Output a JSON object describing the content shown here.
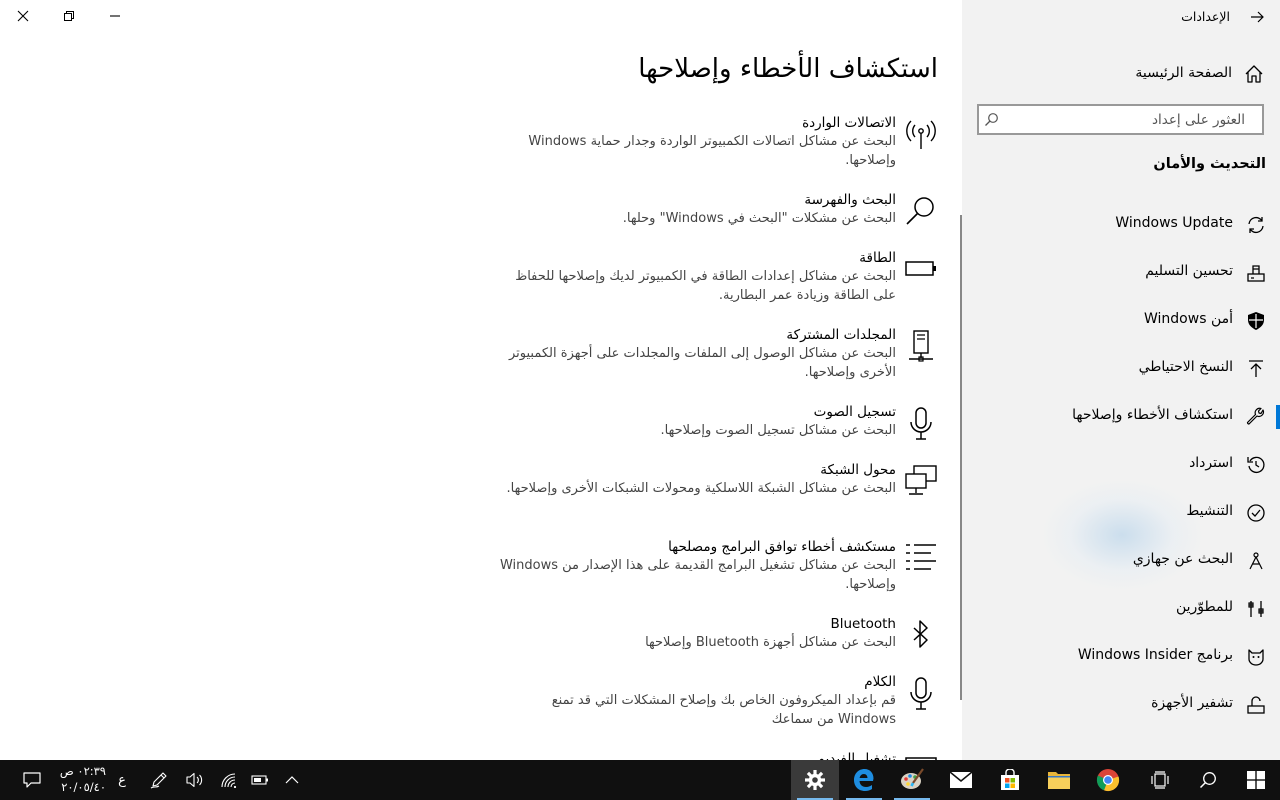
{
  "window": {
    "controls": {
      "close": "close",
      "restore": "restore",
      "minimize": "minimize"
    }
  },
  "main": {
    "title": "استكشاف الأخطاء وإصلاحها",
    "troubleshooters": [
      {
        "name": "الاتصالات الواردة",
        "description": "البحث عن مشاكل اتصالات الكمبيوتر الواردة وجدار حماية Windows وإصلاحها.",
        "icon": "antenna-icon"
      },
      {
        "name": "البحث والفهرسة",
        "description": "البحث عن مشكلات \"البحث في Windows\" وحلها.",
        "icon": "search-icon"
      },
      {
        "name": "الطاقة",
        "description": "البحث عن مشاكل إعدادات الطاقة في الكمبيوتر لديك وإصلاحها للحفاظ على الطاقة وزيادة عمر البطارية.",
        "icon": "battery-icon"
      },
      {
        "name": "المجلدات المشتركة",
        "description": "البحث عن مشاكل الوصول إلى الملفات والمجلدات على أجهزة الكمبيوتر الأخرى وإصلاحها.",
        "icon": "shared-folder-icon"
      },
      {
        "name": "تسجيل الصوت",
        "description": "البحث عن مشاكل تسجيل الصوت وإصلاحها.",
        "icon": "microphone-icon"
      },
      {
        "name": "محول الشبكة",
        "description": "البحث عن مشاكل الشبكة اللاسلكية ومحولات الشبكات الأخرى وإصلاحها.",
        "icon": "network-adapter-icon"
      },
      {
        "name": "مستكشف أخطاء توافق البرامج ومصلحها",
        "description": "البحث عن مشاكل تشغيل البرامج القديمة على هذا الإصدار من Windows وإصلاحها.",
        "icon": "list-icon"
      },
      {
        "name": "Bluetooth",
        "description": "البحث عن مشاكل أجهزة Bluetooth وإصلاحها",
        "icon": "bluetooth-icon"
      },
      {
        "name": "الكلام",
        "description": "قم بإعداد الميكروفون الخاص بك وإصلاح المشكلات التي قد تمنع Windows من سماعك",
        "icon": "microphone-icon"
      },
      {
        "name": "تشغيل الفيديو",
        "description": "",
        "icon": "video-icon"
      }
    ]
  },
  "sidebar": {
    "app_title": "الإعدادات",
    "home_label": "الصفحة الرئيسية",
    "search_placeholder": "العثور على إعداد",
    "section_title": "التحديث والأمان",
    "items": [
      {
        "label": "Windows Update",
        "icon": "sync-icon"
      },
      {
        "label": "تحسين التسليم",
        "icon": "delivery-optimization-icon"
      },
      {
        "label": "أمن Windows",
        "icon": "shield-icon"
      },
      {
        "label": "النسخ الاحتياطي",
        "icon": "backup-icon"
      },
      {
        "label": "استكشاف الأخطاء وإصلاحها",
        "icon": "wrench-icon",
        "selected": true
      },
      {
        "label": "استرداد",
        "icon": "recovery-icon"
      },
      {
        "label": "التنشيط",
        "icon": "activation-icon"
      },
      {
        "label": "البحث عن جهازي",
        "icon": "find-device-icon"
      },
      {
        "label": "للمطوّرين",
        "icon": "developer-icon"
      },
      {
        "label": "برنامج Windows Insider",
        "icon": "insider-icon"
      },
      {
        "label": "تشفير الأجهزة",
        "icon": "encryption-icon"
      }
    ],
    "accent_color": "#0078d7"
  },
  "taskbar": {
    "clock": {
      "time": "٠٢:٣٩ ص",
      "date": "٢٠/٠٥/٤٠"
    },
    "input_indicator": "ع",
    "apps": [
      "settings",
      "edge",
      "paint",
      "mail",
      "store",
      "file-explorer",
      "chrome",
      "task-view",
      "search",
      "start"
    ]
  }
}
